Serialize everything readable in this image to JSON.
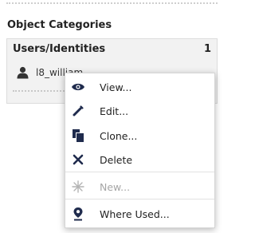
{
  "section": {
    "title": "Object Categories"
  },
  "panel": {
    "title": "Users/Identities",
    "count": "1",
    "item_label": "l8_william"
  },
  "context_menu": {
    "items": [
      {
        "label": "View...",
        "icon": "eye-icon",
        "enabled": true
      },
      {
        "label": "Edit...",
        "icon": "pencil-icon",
        "enabled": true
      },
      {
        "label": "Clone...",
        "icon": "clone-icon",
        "enabled": true
      },
      {
        "label": "Delete",
        "icon": "x-icon",
        "enabled": true
      },
      {
        "label": "New...",
        "icon": "new-icon",
        "enabled": false
      },
      {
        "label": "Where Used...",
        "icon": "location-pin-icon",
        "enabled": true
      }
    ]
  }
}
